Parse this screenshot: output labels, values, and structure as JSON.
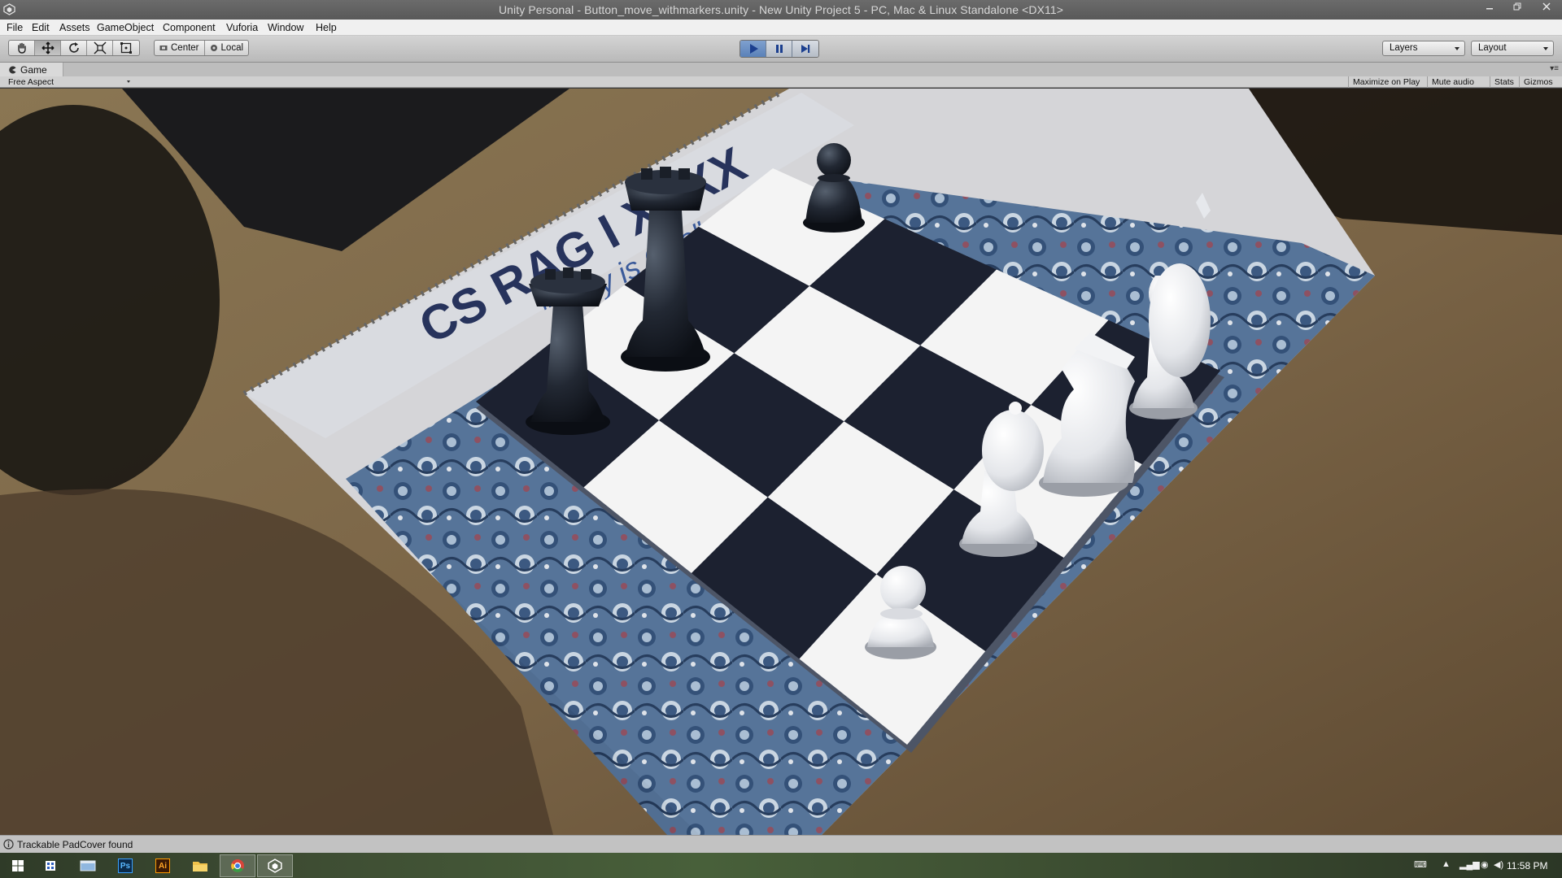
{
  "window": {
    "title": "Unity Personal - Button_move_withmarkers.unity - New Unity Project 5 - PC, Mac & Linux Standalone <DX11>",
    "minimize_icon": "minimize-icon",
    "maximize_icon": "restore-icon",
    "close_icon": "close-icon"
  },
  "menubar": {
    "items": [
      "File",
      "Edit",
      "Assets",
      "GameObject",
      "Component",
      "Vuforia",
      "Window",
      "Help"
    ]
  },
  "toolbar": {
    "tools": [
      "hand-tool-icon",
      "move-tool-icon",
      "rotate-tool-icon",
      "scale-tool-icon",
      "rect-tool-icon"
    ],
    "active_tool": "move-tool-icon",
    "pivot_label": "Center",
    "rotation_label": "Local",
    "play_controls": [
      "play-icon",
      "pause-icon",
      "step-icon"
    ],
    "layers_label": "Layers",
    "layout_label": "Layout"
  },
  "game_panel": {
    "tab_label": "Game",
    "aspect_label": "Free Aspect",
    "options": [
      "Maximize on Play",
      "Mute audio",
      "Stats",
      "Gizmos"
    ],
    "scene_text": {
      "notebook_title": "CS RAG I  XXXX",
      "notebook_subtitle": "\"Unity is One\""
    }
  },
  "status_bar": {
    "message": "Trackable PadCover found"
  },
  "taskbar": {
    "apps": [
      "start-icon",
      "store-icon",
      "explorer-window-icon",
      "photoshop-icon",
      "illustrator-icon",
      "file-explorer-icon",
      "chrome-icon",
      "unity-icon"
    ],
    "photoshop_label": "Ps",
    "illustrator_label": "Ai",
    "clock": "11:58 PM"
  },
  "colors": {
    "titlebar": "#5f5f5f",
    "play_active": "#5a81b8",
    "dark_square": "#1c2130",
    "light_square": "#f4f4f4",
    "desk": "#6d5b43"
  }
}
